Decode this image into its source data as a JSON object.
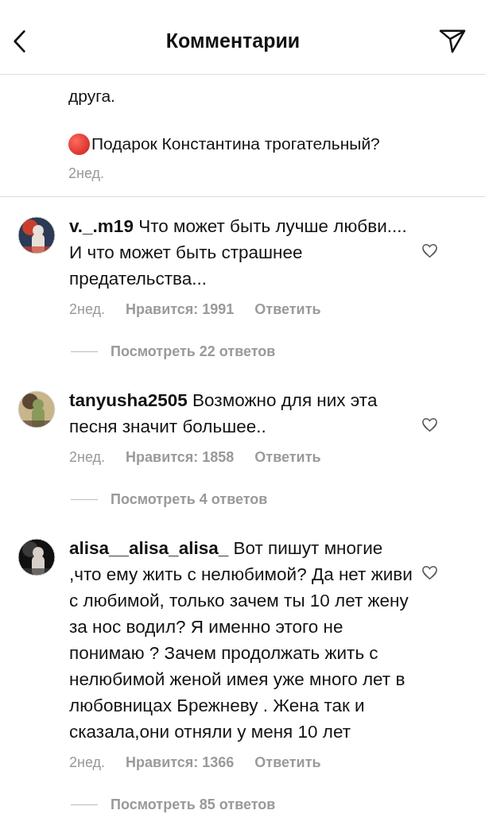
{
  "header": {
    "title": "Комментарии"
  },
  "partial_comment": {
    "paragraphs": [
      "друга.",
      "Подарок Константина трогательный?"
    ],
    "time": "2нед."
  },
  "comments": [
    {
      "username": "v._.m19",
      "text": "Что может быть лучше любви.... И что может быть страшнее предательства...",
      "time": "2нед.",
      "likes": "Нравится: 1991",
      "reply": "Ответить",
      "liked": false,
      "view_replies": "Посмотреть 22 ответов"
    },
    {
      "username": "tanyusha2505",
      "text": "Возможно для них эта песня значит большее..",
      "time": "2нед.",
      "likes": "Нравится: 1858",
      "reply": "Ответить",
      "liked": false,
      "view_replies": "Посмотреть 4 ответов"
    },
    {
      "username": "alisa__alisa_alisa_",
      "text": "Вот пишут многие ,что ему жить с нелюбимой? Да нет живи с любимой, только зачем ты 10 лет жену за нос водил? Я именно этого не понимаю ? Зачем продолжать жить с нелюбимой женой имея уже много лет в любовницах Брежневу . Жена так и сказала,они отняли у меня 10 лет",
      "time": "2нед.",
      "likes": "Нравится: 1366",
      "reply": "Ответить",
      "liked": false,
      "view_replies": "Посмотреть 85 ответов"
    }
  ]
}
